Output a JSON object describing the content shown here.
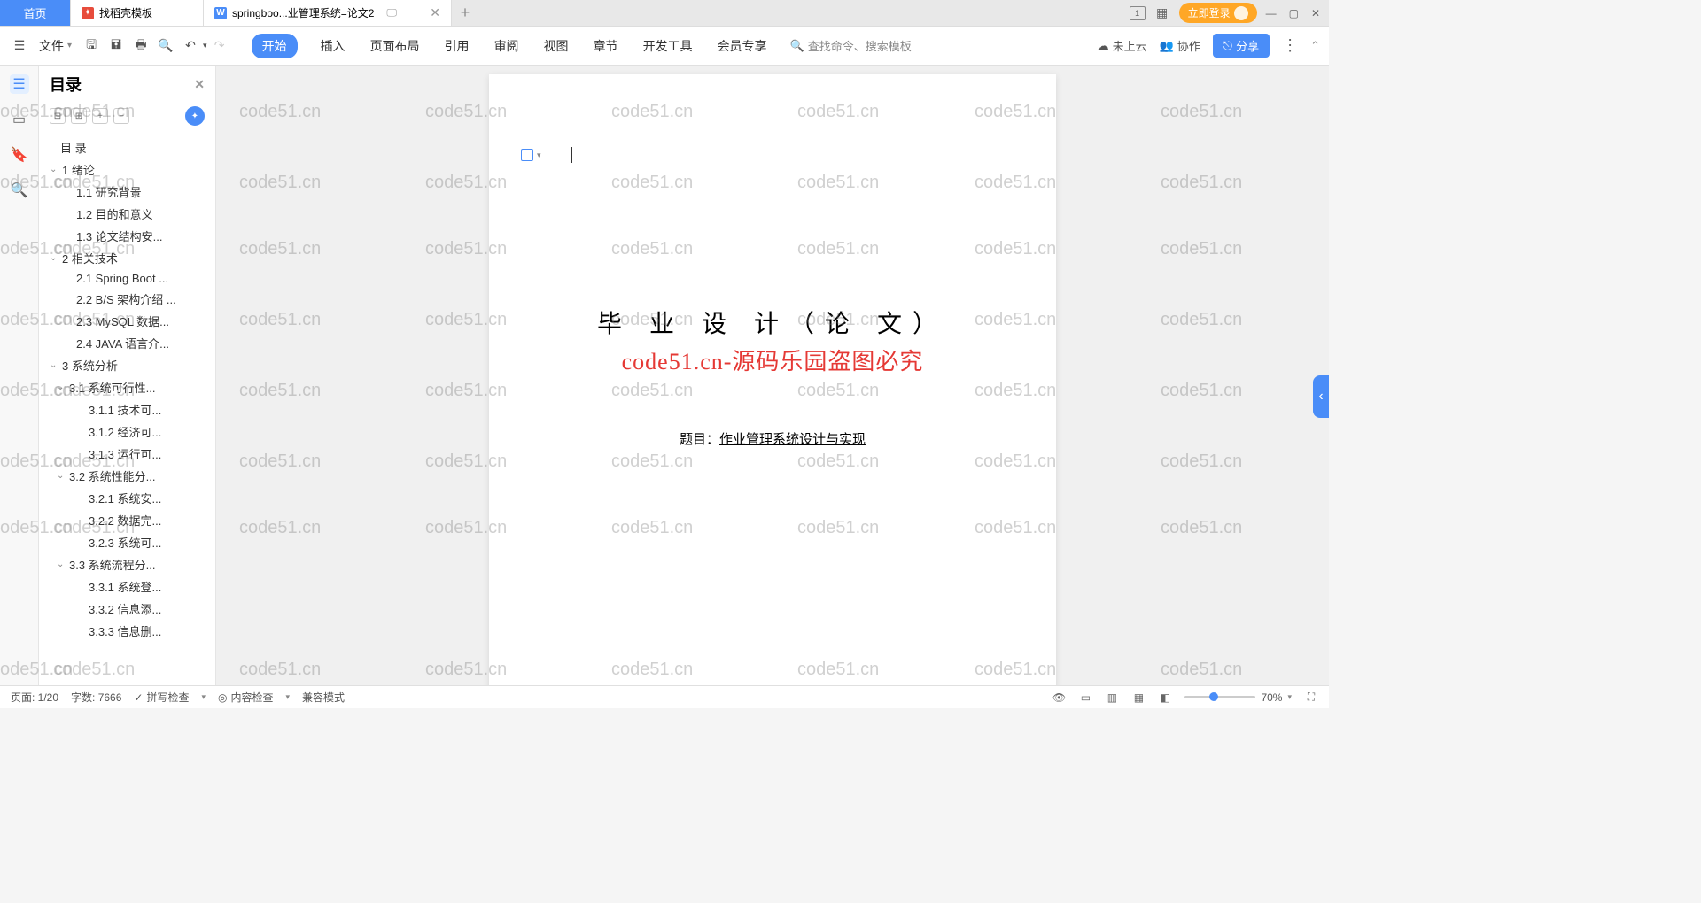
{
  "tabs": {
    "home": "首页",
    "template": "找稻壳模板",
    "active": "springboo...业管理系统=论文2",
    "login": "立即登录"
  },
  "toolbar": {
    "file": "文件",
    "menu": [
      "开始",
      "插入",
      "页面布局",
      "引用",
      "审阅",
      "视图",
      "章节",
      "开发工具",
      "会员专享"
    ],
    "search": "查找命令、搜索模板",
    "cloud": "未上云",
    "collab": "协作",
    "share": "分享"
  },
  "outline": {
    "title": "目录",
    "items": [
      {
        "level": 1,
        "text": "目 录",
        "chevron": false
      },
      {
        "level": 0,
        "text": "1  绪论",
        "chevron": true
      },
      {
        "level": 2,
        "text": "1.1 研究背景"
      },
      {
        "level": 2,
        "text": "1.2 目的和意义"
      },
      {
        "level": 2,
        "text": "1.3 论文结构安..."
      },
      {
        "level": 0,
        "text": "2  相关技术",
        "chevron": true
      },
      {
        "level": 2,
        "text": "2.1 Spring Boot ..."
      },
      {
        "level": 2,
        "text": "2.2 B/S 架构介绍 ..."
      },
      {
        "level": 2,
        "text": "2.3 MySQL 数据..."
      },
      {
        "level": 2,
        "text": "2.4 JAVA 语言介..."
      },
      {
        "level": 0,
        "text": "3  系统分析",
        "chevron": true
      },
      {
        "level": 1,
        "text": "3.1 系统可行性...",
        "chevron": true
      },
      {
        "level": 3,
        "text": "3.1.1 技术可..."
      },
      {
        "level": 3,
        "text": "3.1.2 经济可..."
      },
      {
        "level": 3,
        "text": "3.1.3 运行可..."
      },
      {
        "level": 1,
        "text": "3.2 系统性能分...",
        "chevron": true
      },
      {
        "level": 3,
        "text": "3.2.1 系统安..."
      },
      {
        "level": 3,
        "text": "3.2.2 数据完..."
      },
      {
        "level": 3,
        "text": "3.2.3 系统可..."
      },
      {
        "level": 1,
        "text": "3.3 系统流程分...",
        "chevron": true
      },
      {
        "level": 3,
        "text": "3.3.1 系统登..."
      },
      {
        "level": 3,
        "text": "3.3.2 信息添..."
      },
      {
        "level": 3,
        "text": "3.3.3 信息删..."
      }
    ]
  },
  "document": {
    "title": "毕 业 设 计（论 文）",
    "watermark_red": "code51.cn-源码乐园盗图必究",
    "subject_label": "题目：",
    "subject_value": "作业管理系统设计与实现"
  },
  "status": {
    "page": "页面: 1/20",
    "words": "字数: 7666",
    "spell": "拼写检查",
    "content_check": "内容检查",
    "compat": "兼容模式",
    "zoom": "70%"
  },
  "watermark": "code51.cn"
}
